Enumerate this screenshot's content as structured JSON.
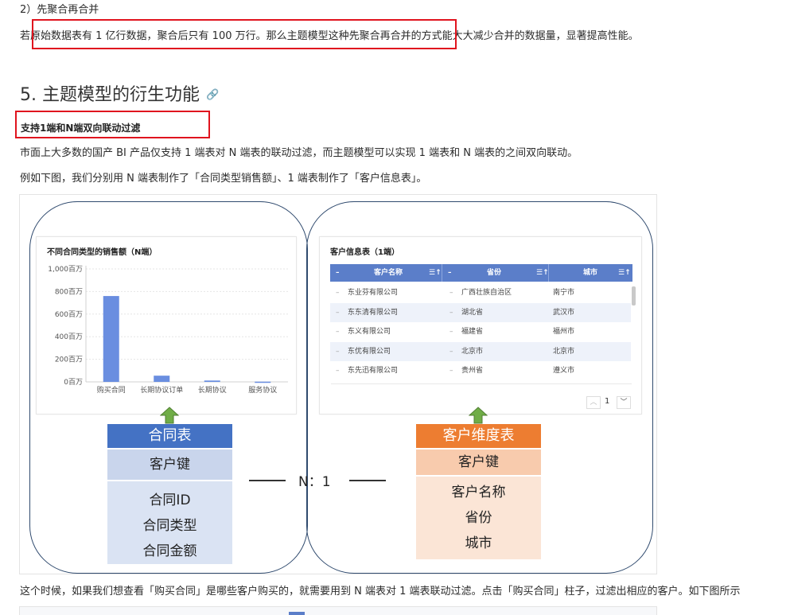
{
  "article": {
    "subheading_2": "2）先聚合再合并",
    "paragraph_1": "若原始数据表有 1 亿行数据，聚合后只有 100 万行。那么主题模型这种先聚合再合并的方式能大大减少合并的数据量，显著提高性能。",
    "section_title": "5. 主题模型的衍生功能",
    "feature_title": "支持1端和N端双向联动过滤",
    "paragraph_2": "市面上大多数的国产 BI 产品仅支持 1 端表对 N 端表的联动过滤，而主题模型可以实现 1 端表和 N 端表的之间双向联动。",
    "paragraph_3": "例如下图，我们分别用 N 端表制作了「合同类型销售额」、1 端表制作了「客户信息表」。",
    "paragraph_4": "这个时候，如果我们想查看「购买合同」是哪些客户购买的，就需要用到 N 端表对 1 端表联动过滤。点击「购买合同」柱子，过滤出相应的客户。如下图所示"
  },
  "figure": {
    "chart_card_title": "不同合同类型的销售额（N端）",
    "table_card_title": "客户信息表（1端）",
    "relation_label": "N：1",
    "left_box": {
      "header": "合同表",
      "key": "客户键",
      "fields": [
        "合同ID",
        "合同类型",
        "合同金额"
      ]
    },
    "right_box": {
      "header": "客户维度表",
      "key": "客户键",
      "fields": [
        "客户名称",
        "省份",
        "城市"
      ]
    },
    "table": {
      "columns": [
        "客户名称",
        "省份",
        "城市"
      ],
      "rows": [
        [
          "东业芬有限公司",
          "广西壮族自治区",
          "南宁市"
        ],
        [
          "东东清有限公司",
          "湖北省",
          "武汉市"
        ],
        [
          "东义有限公司",
          "福建省",
          "福州市"
        ],
        [
          "东优有限公司",
          "北京市",
          "北京市"
        ],
        [
          "东先迅有限公司",
          "贵州省",
          "遵义市"
        ]
      ],
      "page": "1"
    },
    "colors": {
      "bar": "#6a8ee0",
      "header": "#5b7ec9",
      "left_box": "#4472c4",
      "right_box": "#ed7d31",
      "arrow": "#70ad47"
    }
  },
  "chart_data": {
    "type": "bar",
    "title": "不同合同类型的销售额（N端）",
    "categories": [
      "购买合同",
      "长期协议订单",
      "长期协议",
      "服务协议"
    ],
    "values": [
      760,
      55,
      12,
      2
    ],
    "yticks": [
      "1,000百万",
      "800百万",
      "600百万",
      "400百万",
      "200百万",
      "0百万"
    ],
    "ylim": [
      0,
      1000
    ],
    "grid": true
  }
}
